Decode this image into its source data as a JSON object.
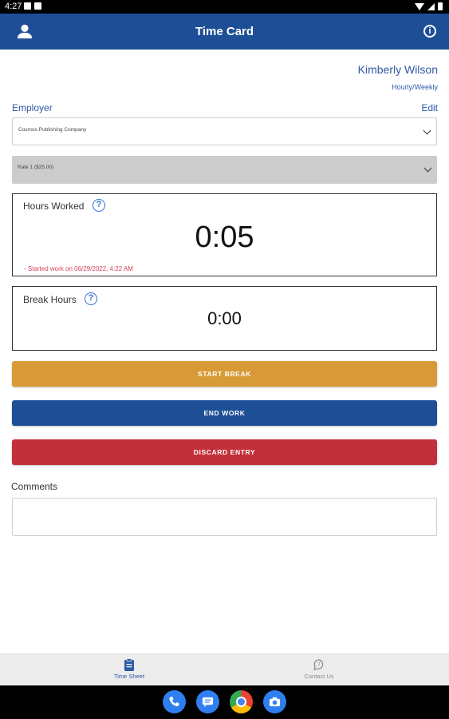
{
  "status_bar": {
    "time": "4:27"
  },
  "app_bar": {
    "title": "Time Card"
  },
  "user": {
    "name": "Kimberly Wilson",
    "pay_type": "Hourly/Weekly"
  },
  "employer": {
    "label": "Employer",
    "edit_label": "Edit",
    "selected": "Cosmos Publishing Company"
  },
  "rate": {
    "selected": "Rate 1 ($25.00)"
  },
  "hours_worked": {
    "label": "Hours Worked",
    "value": "0:05",
    "note": "- Started work on 06/29/2022, 4:22 AM"
  },
  "break_hours": {
    "label": "Break Hours",
    "value": "0:00"
  },
  "buttons": {
    "start_break": "START BREAK",
    "end_work": "END WORK",
    "discard_entry": "DISCARD ENTRY"
  },
  "comments": {
    "label": "Comments",
    "value": ""
  },
  "bottom_nav": [
    {
      "label": "Time Sheet",
      "icon": "clipboard-icon",
      "active": true
    },
    {
      "label": "Contact Us",
      "icon": "help-bubble-icon",
      "active": false
    }
  ],
  "dock_apps": [
    "phone-icon",
    "messages-icon",
    "chrome-icon",
    "camera-icon"
  ],
  "colors": {
    "primary": "#1e4f96",
    "break_button": "#d89a36",
    "discard_button": "#c2303a",
    "link": "#2f5aa5",
    "note_red": "#d6455a"
  }
}
